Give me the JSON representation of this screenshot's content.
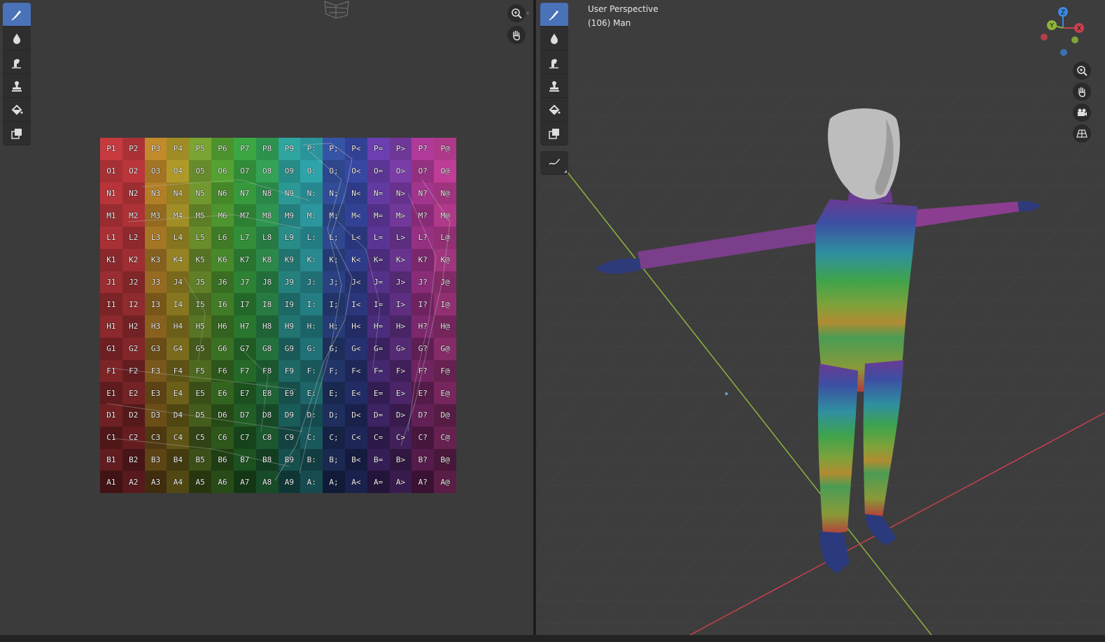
{
  "image_editor": {
    "tools": [
      {
        "name": "draw-brush",
        "active": true
      },
      {
        "name": "soften-brush",
        "active": false
      },
      {
        "name": "smear-brush",
        "active": false
      },
      {
        "name": "clone-stamp",
        "active": false
      },
      {
        "name": "fill-bucket",
        "active": false
      },
      {
        "name": "mask-tool",
        "active": false
      }
    ],
    "uv_rows": [
      "P",
      "O",
      "N",
      "M",
      "L",
      "K",
      "J",
      "I",
      "H",
      "G",
      "F",
      "E",
      "D",
      "C",
      "B",
      "A"
    ],
    "uv_cols": [
      "1",
      "2",
      "3",
      "4",
      "5",
      "6",
      "7",
      "8",
      "9",
      ":",
      ";",
      "<",
      "=",
      ">",
      "?",
      "@"
    ],
    "column_colors": [
      "#c63a3f",
      "#c2393e",
      "#c18a2b",
      "#b6a02b",
      "#7aa532",
      "#57a834",
      "#3ba742",
      "#35a75a",
      "#2fa5a0",
      "#31a9b1",
      "#3654a6",
      "#3a4aa8",
      "#6b3fb0",
      "#7f3fae",
      "#b0399a",
      "#c6409c"
    ]
  },
  "viewport": {
    "view_name": "User Perspective",
    "object_info": "(106) Man",
    "tools": [
      {
        "name": "draw-brush",
        "active": true
      },
      {
        "name": "soften-brush",
        "active": false
      },
      {
        "name": "smear-brush",
        "active": false
      },
      {
        "name": "clone-stamp",
        "active": false
      },
      {
        "name": "fill-bucket",
        "active": false
      },
      {
        "name": "mask-tool",
        "active": false
      }
    ],
    "annotate_tool": "annotate-tool",
    "gizmo": {
      "z": "Z",
      "y": "Y",
      "x": "X"
    },
    "nav_controls": [
      "zoom-icon",
      "hand-pan-icon",
      "camera-icon",
      "grid-perspective-icon"
    ],
    "colors": {
      "x_axis": "#c94050",
      "y_axis": "#8db43a",
      "z_axis": "#3c88e0",
      "active_tool": "#4a72b8"
    }
  }
}
